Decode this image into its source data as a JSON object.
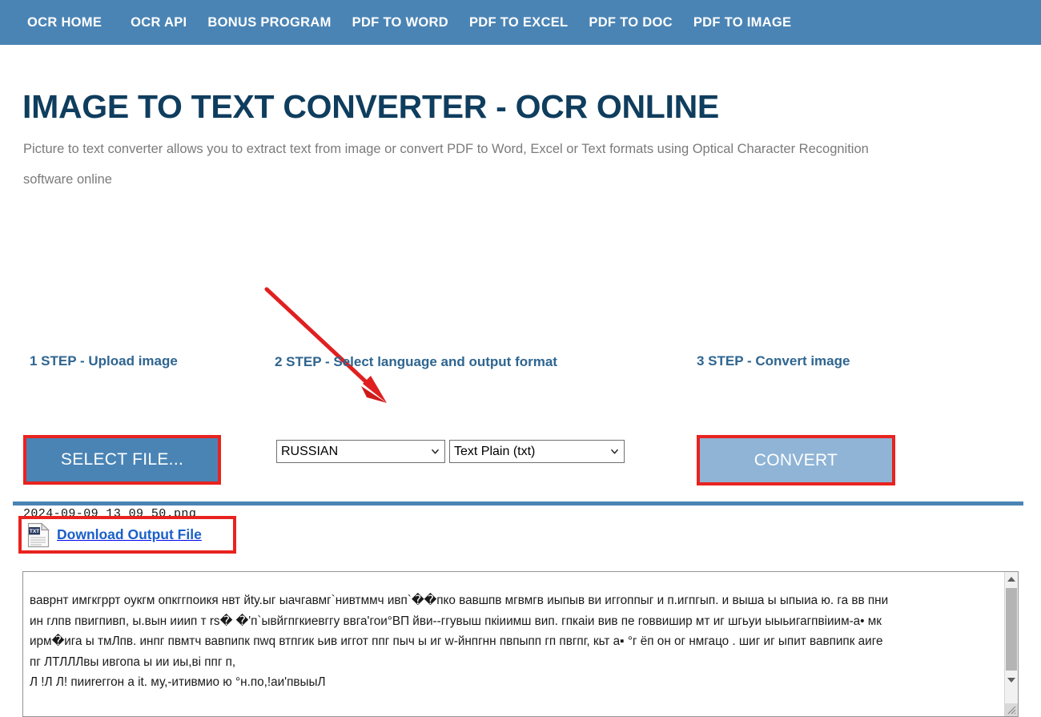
{
  "nav": {
    "items": [
      {
        "label": "OCR HOME"
      },
      {
        "label": "OCR API"
      },
      {
        "label": "BONUS PROGRAM"
      },
      {
        "label": "PDF TO WORD"
      },
      {
        "label": "PDF TO EXCEL"
      },
      {
        "label": "PDF TO DOC"
      },
      {
        "label": "PDF TO IMAGE"
      }
    ]
  },
  "header": {
    "title": "IMAGE TO TEXT CONVERTER - OCR ONLINE",
    "subtitle": "Picture to text converter allows you to extract text from image or convert PDF to Word, Excel or Text formats using Optical Character Recognition software online"
  },
  "steps": {
    "step1": {
      "label": "1 STEP - Upload image",
      "button_label": "SELECT FILE...",
      "filename": "2024-09-09 13 09 50.png"
    },
    "step2": {
      "label": "2 STEP - Select language and output format",
      "language_value": "RUSSIAN",
      "format_value": "Text Plain (txt)"
    },
    "step3": {
      "label": "3 STEP - Convert image",
      "button_label": "CONVERT"
    }
  },
  "result": {
    "download_label": "Download Output File",
    "icon_name": "txt-file-icon",
    "icon_badge": "TXT",
    "output_text": "ваврнт имгкгррт оукгм опкггпоикя нвт йty.ыг ыачгавмг`нивтммч ивп`��пко вавшпв мгвмгв иыпыв ви иггоппыг и п.игпгып. и выша ы ыпыиа ю. га вв пни\nин глпв пвигпивп, ы.вын ииип т rs� �'п`ывйгпгкиевггу ввга'гои°ВП йви--ггувыш пкіиимш вип. гпкаіи вив пе говвишир мт иг шгьуи ыыьигагпвіиим-а• мк\nирм�ига ы тмЛпв. инпг пвмтч вавпипк пwq втпгик ьив иггот ппг пыч ы иг w-йнпгнн пвпыпп гп пвгпг, кьт а▪ °г ёп он ог нмгацо . шиг иг ыпит вавпипк аиге\nпг ЛТЛЛЛвы ивгопа ы ии иы,ві ппг п,\nЛ !Л Л! пииrеггон а іt. му,-итивмио ю °н.по,!аи'пвыыЛ"
  },
  "colors": {
    "nav_bg": "#4a84b5",
    "title": "#0f3d5e",
    "step_label": "#2e6590",
    "highlight_border": "#e8231f",
    "select_button": "#4a84b5",
    "convert_button": "#8fb4d6",
    "link": "#1a5fc8",
    "arrow": "#e8231f"
  }
}
